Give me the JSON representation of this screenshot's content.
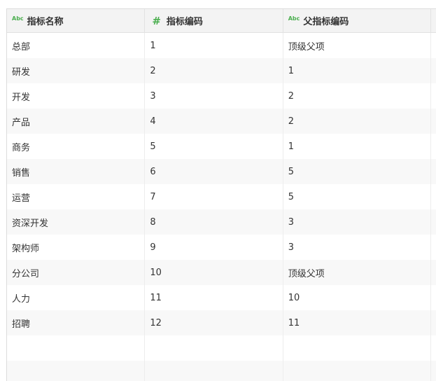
{
  "table": {
    "columns": [
      {
        "type_icon": "Abc",
        "label": "指标名称"
      },
      {
        "type_icon": "#",
        "label": "指标编码"
      },
      {
        "type_icon": "Abc",
        "label": "父指标编码"
      }
    ],
    "rows": [
      [
        "总部",
        "1",
        "顶级父项"
      ],
      [
        "研发",
        "2",
        "1"
      ],
      [
        "开发",
        "3",
        "2"
      ],
      [
        "产品",
        "4",
        "2"
      ],
      [
        "商务",
        "5",
        "1"
      ],
      [
        "销售",
        "6",
        "5"
      ],
      [
        "运营",
        "7",
        "5"
      ],
      [
        "资深开发",
        "8",
        "3"
      ],
      [
        "架构师",
        "9",
        "3"
      ],
      [
        "分公司",
        "10",
        "顶级父项"
      ],
      [
        "人力",
        "11",
        "10"
      ],
      [
        "招聘",
        "12",
        "11"
      ],
      [
        "",
        "",
        ""
      ],
      [
        "",
        "",
        ""
      ]
    ]
  },
  "colors": {
    "type_icon": "#4caf50",
    "header_bg": "#f3f3f3",
    "row_stripe": "#f8f8f8"
  }
}
